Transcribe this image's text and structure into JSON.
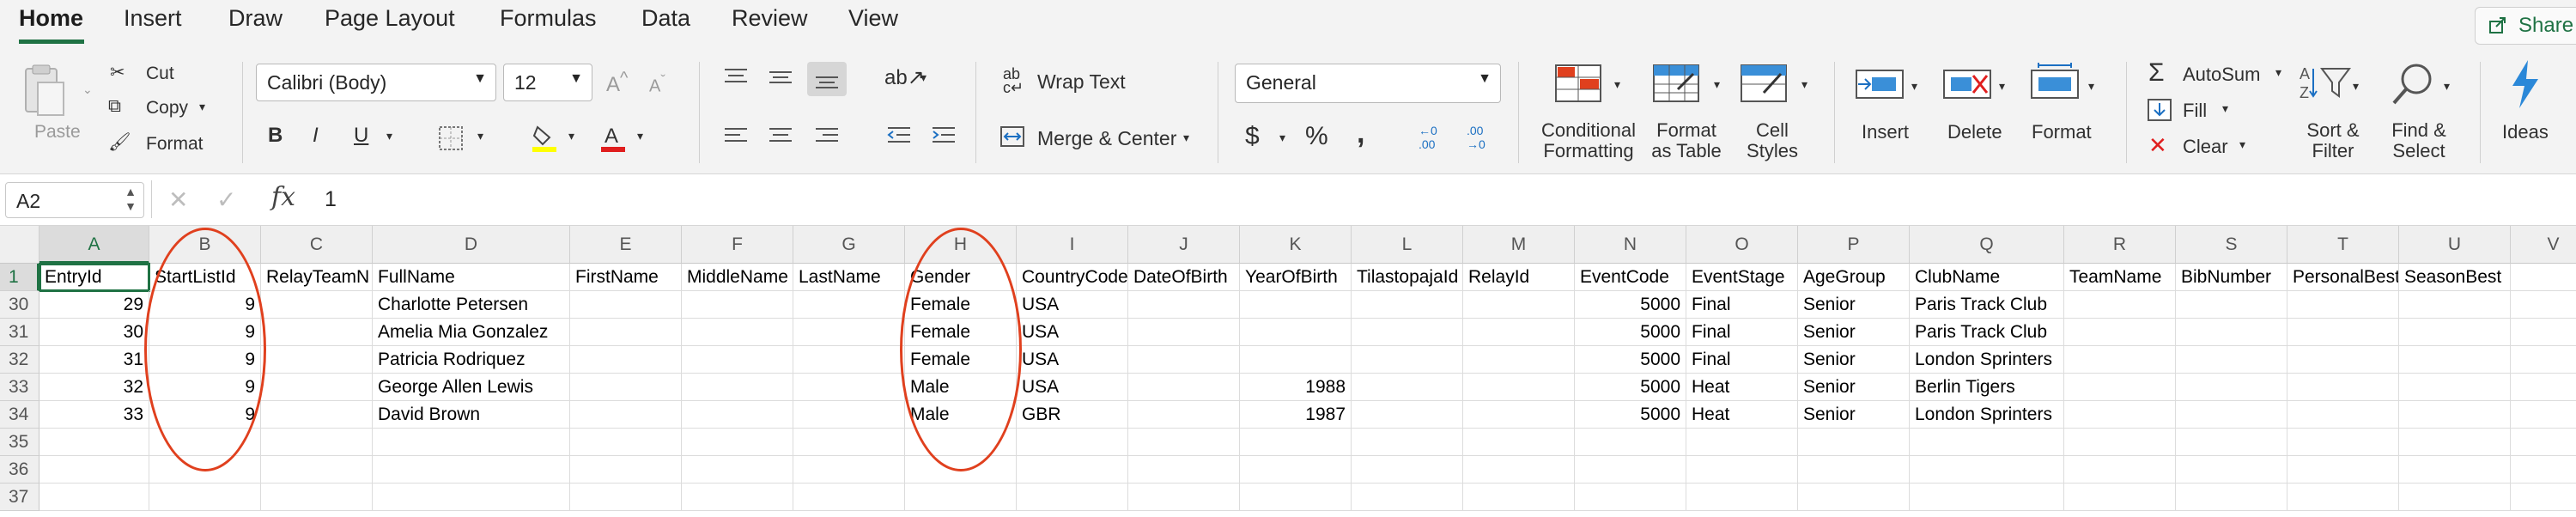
{
  "tabs": [
    "Home",
    "Insert",
    "Draw",
    "Page Layout",
    "Formulas",
    "Data",
    "Review",
    "View"
  ],
  "share_label": "Share",
  "ribbon": {
    "paste": "Paste",
    "cut": "Cut",
    "copy": "Copy",
    "format_painter": "Format",
    "font_name": "Calibri (Body)",
    "font_size": "12",
    "bold": "B",
    "italic": "I",
    "underline": "U",
    "wrap_text": "Wrap Text",
    "merge_center": "Merge & Center",
    "number_format": "General",
    "currency": "$",
    "percent": "%",
    "comma": ",",
    "cond_format": "Conditional\nFormatting",
    "format_table": "Format\nas Table",
    "cell_styles": "Cell\nStyles",
    "insert": "Insert",
    "delete": "Delete",
    "format": "Format",
    "autosum": "AutoSum",
    "fill": "Fill",
    "clear": "Clear",
    "sort_filter": "Sort &\nFilter",
    "find_select": "Find &\nSelect",
    "ideas": "Ideas"
  },
  "formula_bar": {
    "name_box": "A2",
    "fx": "fx",
    "value": "1"
  },
  "columns": [
    "A",
    "B",
    "C",
    "D",
    "E",
    "F",
    "G",
    "H",
    "I",
    "J",
    "K",
    "L",
    "M",
    "N",
    "O",
    "P",
    "Q",
    "R",
    "S",
    "T",
    "U",
    "V"
  ],
  "rows": [
    {
      "num": "1",
      "cells": [
        "EntryId",
        "StartListId",
        "RelayTeamN",
        "FullName",
        "FirstName",
        "MiddleName",
        "LastName",
        "Gender",
        "CountryCode",
        "DateOfBirth",
        "YearOfBirth",
        "TilastopajaId",
        "RelayId",
        "EventCode",
        "EventStage",
        "AgeGroup",
        "ClubName",
        "TeamName",
        "BibNumber",
        "PersonalBest",
        "SeasonBest",
        ""
      ]
    },
    {
      "num": "30",
      "cells": [
        "29",
        "9",
        "",
        "Charlotte Petersen",
        "",
        "",
        "",
        "Female",
        "USA",
        "",
        "",
        "",
        "",
        "5000",
        "Final",
        "Senior",
        "Paris Track Club",
        "",
        "",
        "",
        "",
        ""
      ]
    },
    {
      "num": "31",
      "cells": [
        "30",
        "9",
        "",
        "Amelia Mia Gonzalez",
        "",
        "",
        "",
        "Female",
        "USA",
        "",
        "",
        "",
        "",
        "5000",
        "Final",
        "Senior",
        "Paris Track Club",
        "",
        "",
        "",
        "",
        ""
      ]
    },
    {
      "num": "32",
      "cells": [
        "31",
        "9",
        "",
        "Patricia Rodriquez",
        "",
        "",
        "",
        "Female",
        "USA",
        "",
        "",
        "",
        "",
        "5000",
        "Final",
        "Senior",
        "London Sprinters",
        "",
        "",
        "",
        "",
        ""
      ]
    },
    {
      "num": "33",
      "cells": [
        "32",
        "9",
        "",
        "George Allen Lewis",
        "",
        "",
        "",
        "Male",
        "USA",
        "",
        "1988",
        "",
        "",
        "5000",
        "Heat",
        "Senior",
        "Berlin Tigers",
        "",
        "",
        "",
        "",
        ""
      ]
    },
    {
      "num": "34",
      "cells": [
        "33",
        "9",
        "",
        "David Brown",
        "",
        "",
        "",
        "Male",
        "GBR",
        "",
        "1987",
        "",
        "",
        "5000",
        "Heat",
        "Senior",
        "London Sprinters",
        "",
        "",
        "",
        "",
        ""
      ]
    },
    {
      "num": "35",
      "cells": [
        "",
        "",
        "",
        "",
        "",
        "",
        "",
        "",
        "",
        "",
        "",
        "",
        "",
        "",
        "",
        "",
        "",
        "",
        "",
        "",
        "",
        ""
      ]
    },
    {
      "num": "36",
      "cells": [
        "",
        "",
        "",
        "",
        "",
        "",
        "",
        "",
        "",
        "",
        "",
        "",
        "",
        "",
        "",
        "",
        "",
        "",
        "",
        "",
        "",
        ""
      ]
    },
    {
      "num": "37",
      "cells": [
        "",
        "",
        "",
        "",
        "",
        "",
        "",
        "",
        "",
        "",
        "",
        "",
        "",
        "",
        "",
        "",
        "",
        "",
        "",
        "",
        "",
        ""
      ]
    }
  ],
  "numeric_columns": [
    0,
    1,
    10,
    13
  ],
  "selected_cell": "A2",
  "annotations": [
    "red oval around column B",
    "red oval around column H"
  ],
  "colors": {
    "accent": "#1f7244",
    "annotation": "#e0401e"
  }
}
